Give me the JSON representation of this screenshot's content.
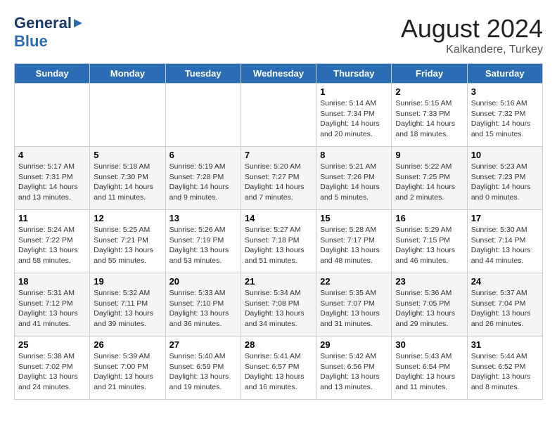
{
  "header": {
    "logo_general": "General",
    "logo_blue": "Blue",
    "month_year": "August 2024",
    "location": "Kalkandere, Turkey"
  },
  "days_of_week": [
    "Sunday",
    "Monday",
    "Tuesday",
    "Wednesday",
    "Thursday",
    "Friday",
    "Saturday"
  ],
  "weeks": [
    [
      {
        "day": "",
        "info": ""
      },
      {
        "day": "",
        "info": ""
      },
      {
        "day": "",
        "info": ""
      },
      {
        "day": "",
        "info": ""
      },
      {
        "day": "1",
        "info": "Sunrise: 5:14 AM\nSunset: 7:34 PM\nDaylight: 14 hours\nand 20 minutes."
      },
      {
        "day": "2",
        "info": "Sunrise: 5:15 AM\nSunset: 7:33 PM\nDaylight: 14 hours\nand 18 minutes."
      },
      {
        "day": "3",
        "info": "Sunrise: 5:16 AM\nSunset: 7:32 PM\nDaylight: 14 hours\nand 15 minutes."
      }
    ],
    [
      {
        "day": "4",
        "info": "Sunrise: 5:17 AM\nSunset: 7:31 PM\nDaylight: 14 hours\nand 13 minutes."
      },
      {
        "day": "5",
        "info": "Sunrise: 5:18 AM\nSunset: 7:30 PM\nDaylight: 14 hours\nand 11 minutes."
      },
      {
        "day": "6",
        "info": "Sunrise: 5:19 AM\nSunset: 7:28 PM\nDaylight: 14 hours\nand 9 minutes."
      },
      {
        "day": "7",
        "info": "Sunrise: 5:20 AM\nSunset: 7:27 PM\nDaylight: 14 hours\nand 7 minutes."
      },
      {
        "day": "8",
        "info": "Sunrise: 5:21 AM\nSunset: 7:26 PM\nDaylight: 14 hours\nand 5 minutes."
      },
      {
        "day": "9",
        "info": "Sunrise: 5:22 AM\nSunset: 7:25 PM\nDaylight: 14 hours\nand 2 minutes."
      },
      {
        "day": "10",
        "info": "Sunrise: 5:23 AM\nSunset: 7:23 PM\nDaylight: 14 hours\nand 0 minutes."
      }
    ],
    [
      {
        "day": "11",
        "info": "Sunrise: 5:24 AM\nSunset: 7:22 PM\nDaylight: 13 hours\nand 58 minutes."
      },
      {
        "day": "12",
        "info": "Sunrise: 5:25 AM\nSunset: 7:21 PM\nDaylight: 13 hours\nand 55 minutes."
      },
      {
        "day": "13",
        "info": "Sunrise: 5:26 AM\nSunset: 7:19 PM\nDaylight: 13 hours\nand 53 minutes."
      },
      {
        "day": "14",
        "info": "Sunrise: 5:27 AM\nSunset: 7:18 PM\nDaylight: 13 hours\nand 51 minutes."
      },
      {
        "day": "15",
        "info": "Sunrise: 5:28 AM\nSunset: 7:17 PM\nDaylight: 13 hours\nand 48 minutes."
      },
      {
        "day": "16",
        "info": "Sunrise: 5:29 AM\nSunset: 7:15 PM\nDaylight: 13 hours\nand 46 minutes."
      },
      {
        "day": "17",
        "info": "Sunrise: 5:30 AM\nSunset: 7:14 PM\nDaylight: 13 hours\nand 44 minutes."
      }
    ],
    [
      {
        "day": "18",
        "info": "Sunrise: 5:31 AM\nSunset: 7:12 PM\nDaylight: 13 hours\nand 41 minutes."
      },
      {
        "day": "19",
        "info": "Sunrise: 5:32 AM\nSunset: 7:11 PM\nDaylight: 13 hours\nand 39 minutes."
      },
      {
        "day": "20",
        "info": "Sunrise: 5:33 AM\nSunset: 7:10 PM\nDaylight: 13 hours\nand 36 minutes."
      },
      {
        "day": "21",
        "info": "Sunrise: 5:34 AM\nSunset: 7:08 PM\nDaylight: 13 hours\nand 34 minutes."
      },
      {
        "day": "22",
        "info": "Sunrise: 5:35 AM\nSunset: 7:07 PM\nDaylight: 13 hours\nand 31 minutes."
      },
      {
        "day": "23",
        "info": "Sunrise: 5:36 AM\nSunset: 7:05 PM\nDaylight: 13 hours\nand 29 minutes."
      },
      {
        "day": "24",
        "info": "Sunrise: 5:37 AM\nSunset: 7:04 PM\nDaylight: 13 hours\nand 26 minutes."
      }
    ],
    [
      {
        "day": "25",
        "info": "Sunrise: 5:38 AM\nSunset: 7:02 PM\nDaylight: 13 hours\nand 24 minutes."
      },
      {
        "day": "26",
        "info": "Sunrise: 5:39 AM\nSunset: 7:00 PM\nDaylight: 13 hours\nand 21 minutes."
      },
      {
        "day": "27",
        "info": "Sunrise: 5:40 AM\nSunset: 6:59 PM\nDaylight: 13 hours\nand 19 minutes."
      },
      {
        "day": "28",
        "info": "Sunrise: 5:41 AM\nSunset: 6:57 PM\nDaylight: 13 hours\nand 16 minutes."
      },
      {
        "day": "29",
        "info": "Sunrise: 5:42 AM\nSunset: 6:56 PM\nDaylight: 13 hours\nand 13 minutes."
      },
      {
        "day": "30",
        "info": "Sunrise: 5:43 AM\nSunset: 6:54 PM\nDaylight: 13 hours\nand 11 minutes."
      },
      {
        "day": "31",
        "info": "Sunrise: 5:44 AM\nSunset: 6:52 PM\nDaylight: 13 hours\nand 8 minutes."
      }
    ]
  ]
}
